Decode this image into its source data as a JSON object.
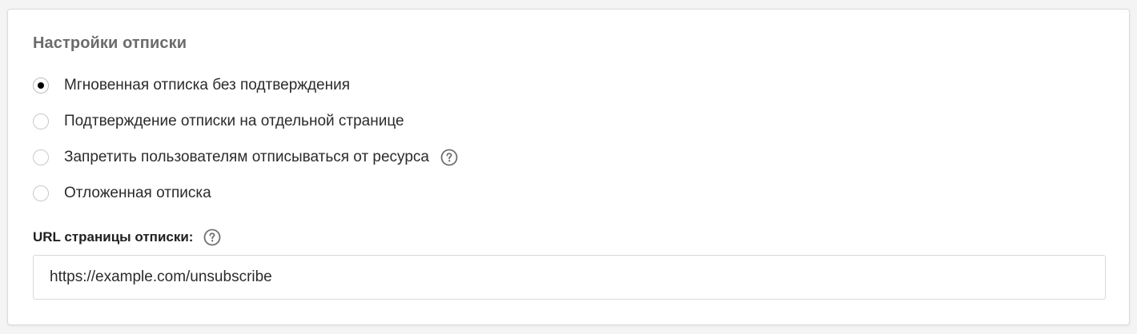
{
  "section": {
    "title": "Настройки отписки"
  },
  "options": [
    {
      "label": "Мгновенная отписка без подтверждения",
      "checked": true,
      "has_help": false
    },
    {
      "label": "Подтверждение отписки на отдельной странице",
      "checked": false,
      "has_help": false
    },
    {
      "label": "Запретить пользователям отписываться от ресурса",
      "checked": false,
      "has_help": true
    },
    {
      "label": "Отложенная отписка",
      "checked": false,
      "has_help": false
    }
  ],
  "url_field": {
    "label": "URL страницы отписки:",
    "value": "https://example.com/unsubscribe",
    "help_icon": "question-circle-icon"
  },
  "colors": {
    "title": "#6b6b6b",
    "text": "#2b2b2b",
    "radio_dot": "#000000",
    "border": "#d9d9d9"
  }
}
